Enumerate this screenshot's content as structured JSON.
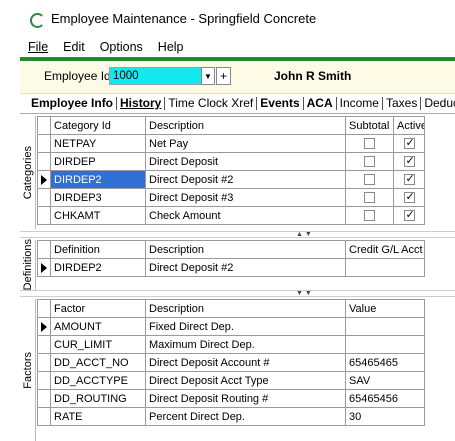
{
  "window": {
    "title": "Employee Maintenance - Springfield Concrete"
  },
  "menu": [
    {
      "label": "File"
    },
    {
      "label": "Edit"
    },
    {
      "label": "Options"
    },
    {
      "label": "Help"
    }
  ],
  "employee": {
    "label": "Employee Id",
    "id_value": "1000",
    "name": "John R Smith",
    "field_color": "#13e7f0"
  },
  "tabs": [
    {
      "label": "Employee Info"
    },
    {
      "label": "History"
    },
    {
      "label": "Time Clock Xref"
    },
    {
      "label": "Events"
    },
    {
      "label": "ACA"
    },
    {
      "label": "Income"
    },
    {
      "label": "Taxes"
    },
    {
      "label": "Deduct"
    }
  ],
  "categories": {
    "side_label": "Categories",
    "headers": [
      "Category Id",
      "Description",
      "Subtotal",
      "Active"
    ],
    "rows": [
      {
        "id": "NETPAY",
        "desc": "Net Pay",
        "subtotal": false,
        "active": true
      },
      {
        "id": "DIRDEP",
        "desc": "Direct Deposit",
        "subtotal": false,
        "active": true
      },
      {
        "id": "DIRDEP2",
        "desc": "Direct Deposit #2",
        "subtotal": false,
        "active": true
      },
      {
        "id": "DIRDEP3",
        "desc": "Direct Deposit #3",
        "subtotal": false,
        "active": true
      },
      {
        "id": "CHKAMT",
        "desc": "Check Amount",
        "subtotal": false,
        "active": true
      }
    ],
    "selected_index": 2
  },
  "definitions": {
    "side_label": "Definitions",
    "headers": [
      "Definition",
      "Description",
      "Credit G/L Acct"
    ],
    "rows": [
      {
        "def": "DIRDEP2",
        "desc": "Direct Deposit #2",
        "acct": ""
      }
    ]
  },
  "factors": {
    "side_label": "Factors",
    "headers": [
      "Factor",
      "Description",
      "Value"
    ],
    "rows": [
      {
        "factor": "AMOUNT",
        "desc": "Fixed Direct Dep.",
        "value": ""
      },
      {
        "factor": "CUR_LIMIT",
        "desc": "Maximum Direct Dep.",
        "value": ""
      },
      {
        "factor": "DD_ACCT_NO",
        "desc": "Direct Deposit Account #",
        "value": "65465465"
      },
      {
        "factor": "DD_ACCTYPE",
        "desc": "Direct Deposit Acct Type",
        "value": "SAV"
      },
      {
        "factor": "DD_ROUTING",
        "desc": "Direct Deposit Routing #",
        "value": "65465456"
      },
      {
        "factor": "RATE",
        "desc": "Percent Direct Dep.",
        "value": "30"
      }
    ]
  },
  "colors": {
    "accent_green": "#1f8b2c",
    "selection_blue": "#2f6fd6",
    "header_bg": "#fdfbe6"
  }
}
